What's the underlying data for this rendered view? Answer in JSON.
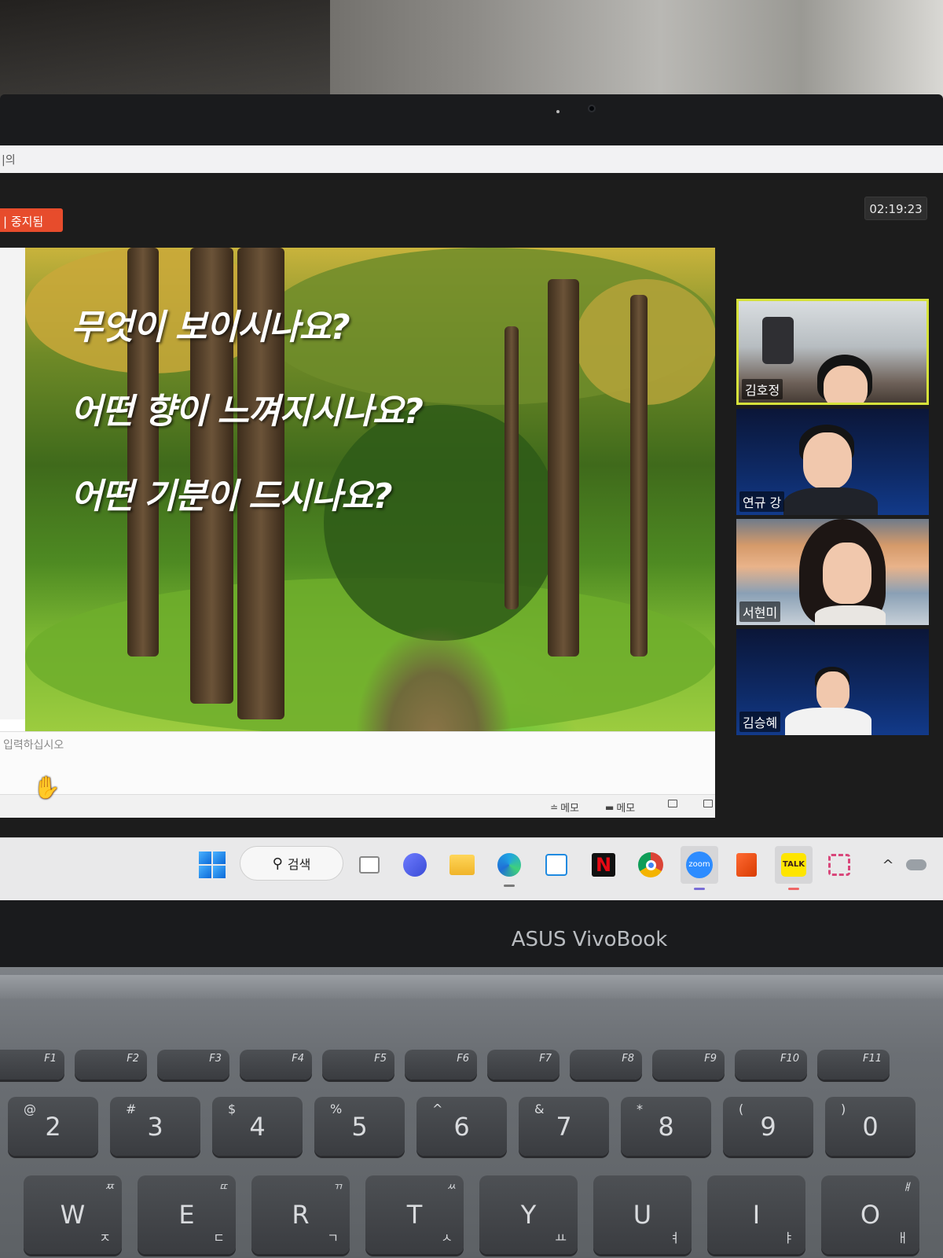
{
  "window": {
    "title_fragment": "|의"
  },
  "meeting": {
    "recording_badge": "| 중지됨",
    "timer": "02:19:23"
  },
  "slide": {
    "lines": [
      "무엇이 보이시나요?",
      "어떤 향이 느껴지시나요?",
      "어떤 기분이 드시나요?"
    ]
  },
  "notes": {
    "placeholder": "입력하십시오"
  },
  "statusbar": {
    "notes_label": "메모",
    "comments_label": "메모"
  },
  "participants": [
    {
      "name": "김호정",
      "active": true
    },
    {
      "name": "연규 강",
      "active": false
    },
    {
      "name": "서현미",
      "active": false
    },
    {
      "name": "김승혜",
      "active": false
    }
  ],
  "taskbar": {
    "search_label": "검색",
    "apps": [
      "start-icon",
      "search",
      "task-view-icon",
      "meet-icon",
      "file-explorer-icon",
      "edge-icon",
      "store-icon",
      "netflix-icon",
      "chrome-icon",
      "zoom-icon",
      "office-icon",
      "kakaotalk-icon",
      "snipping-tool-icon"
    ],
    "netflix_letter": "N",
    "zoom_text": "zoom",
    "kakao_text": "TALK"
  },
  "laptop": {
    "brand": "ASUS VivoBook"
  },
  "keyboard": {
    "fn_row": [
      "F1",
      "F2",
      "F3",
      "F4",
      "F5",
      "F6",
      "F7",
      "F8",
      "F9",
      "F10",
      "F11"
    ],
    "number_row": [
      {
        "main": "2",
        "alt": "@"
      },
      {
        "main": "3",
        "alt": "#"
      },
      {
        "main": "4",
        "alt": "$"
      },
      {
        "main": "5",
        "alt": "%"
      },
      {
        "main": "6",
        "alt": "^"
      },
      {
        "main": "7",
        "alt": "&"
      },
      {
        "main": "8",
        "alt": "*"
      },
      {
        "main": "9",
        "alt": "("
      },
      {
        "main": "0",
        "alt": ")"
      }
    ],
    "letter_row": [
      {
        "main": "W",
        "ko": "ㅈ",
        "ko2": "ㅉ"
      },
      {
        "main": "E",
        "ko": "ㄷ",
        "ko2": "ㄸ"
      },
      {
        "main": "R",
        "ko": "ㄱ",
        "ko2": "ㄲ"
      },
      {
        "main": "T",
        "ko": "ㅅ",
        "ko2": "ㅆ"
      },
      {
        "main": "Y",
        "ko": "ㅛ",
        "ko2": ""
      },
      {
        "main": "U",
        "ko": "ㅕ",
        "ko2": ""
      },
      {
        "main": "I",
        "ko": "ㅑ",
        "ko2": ""
      },
      {
        "main": "O",
        "ko": "ㅐ",
        "ko2": "ㅒ"
      }
    ]
  }
}
